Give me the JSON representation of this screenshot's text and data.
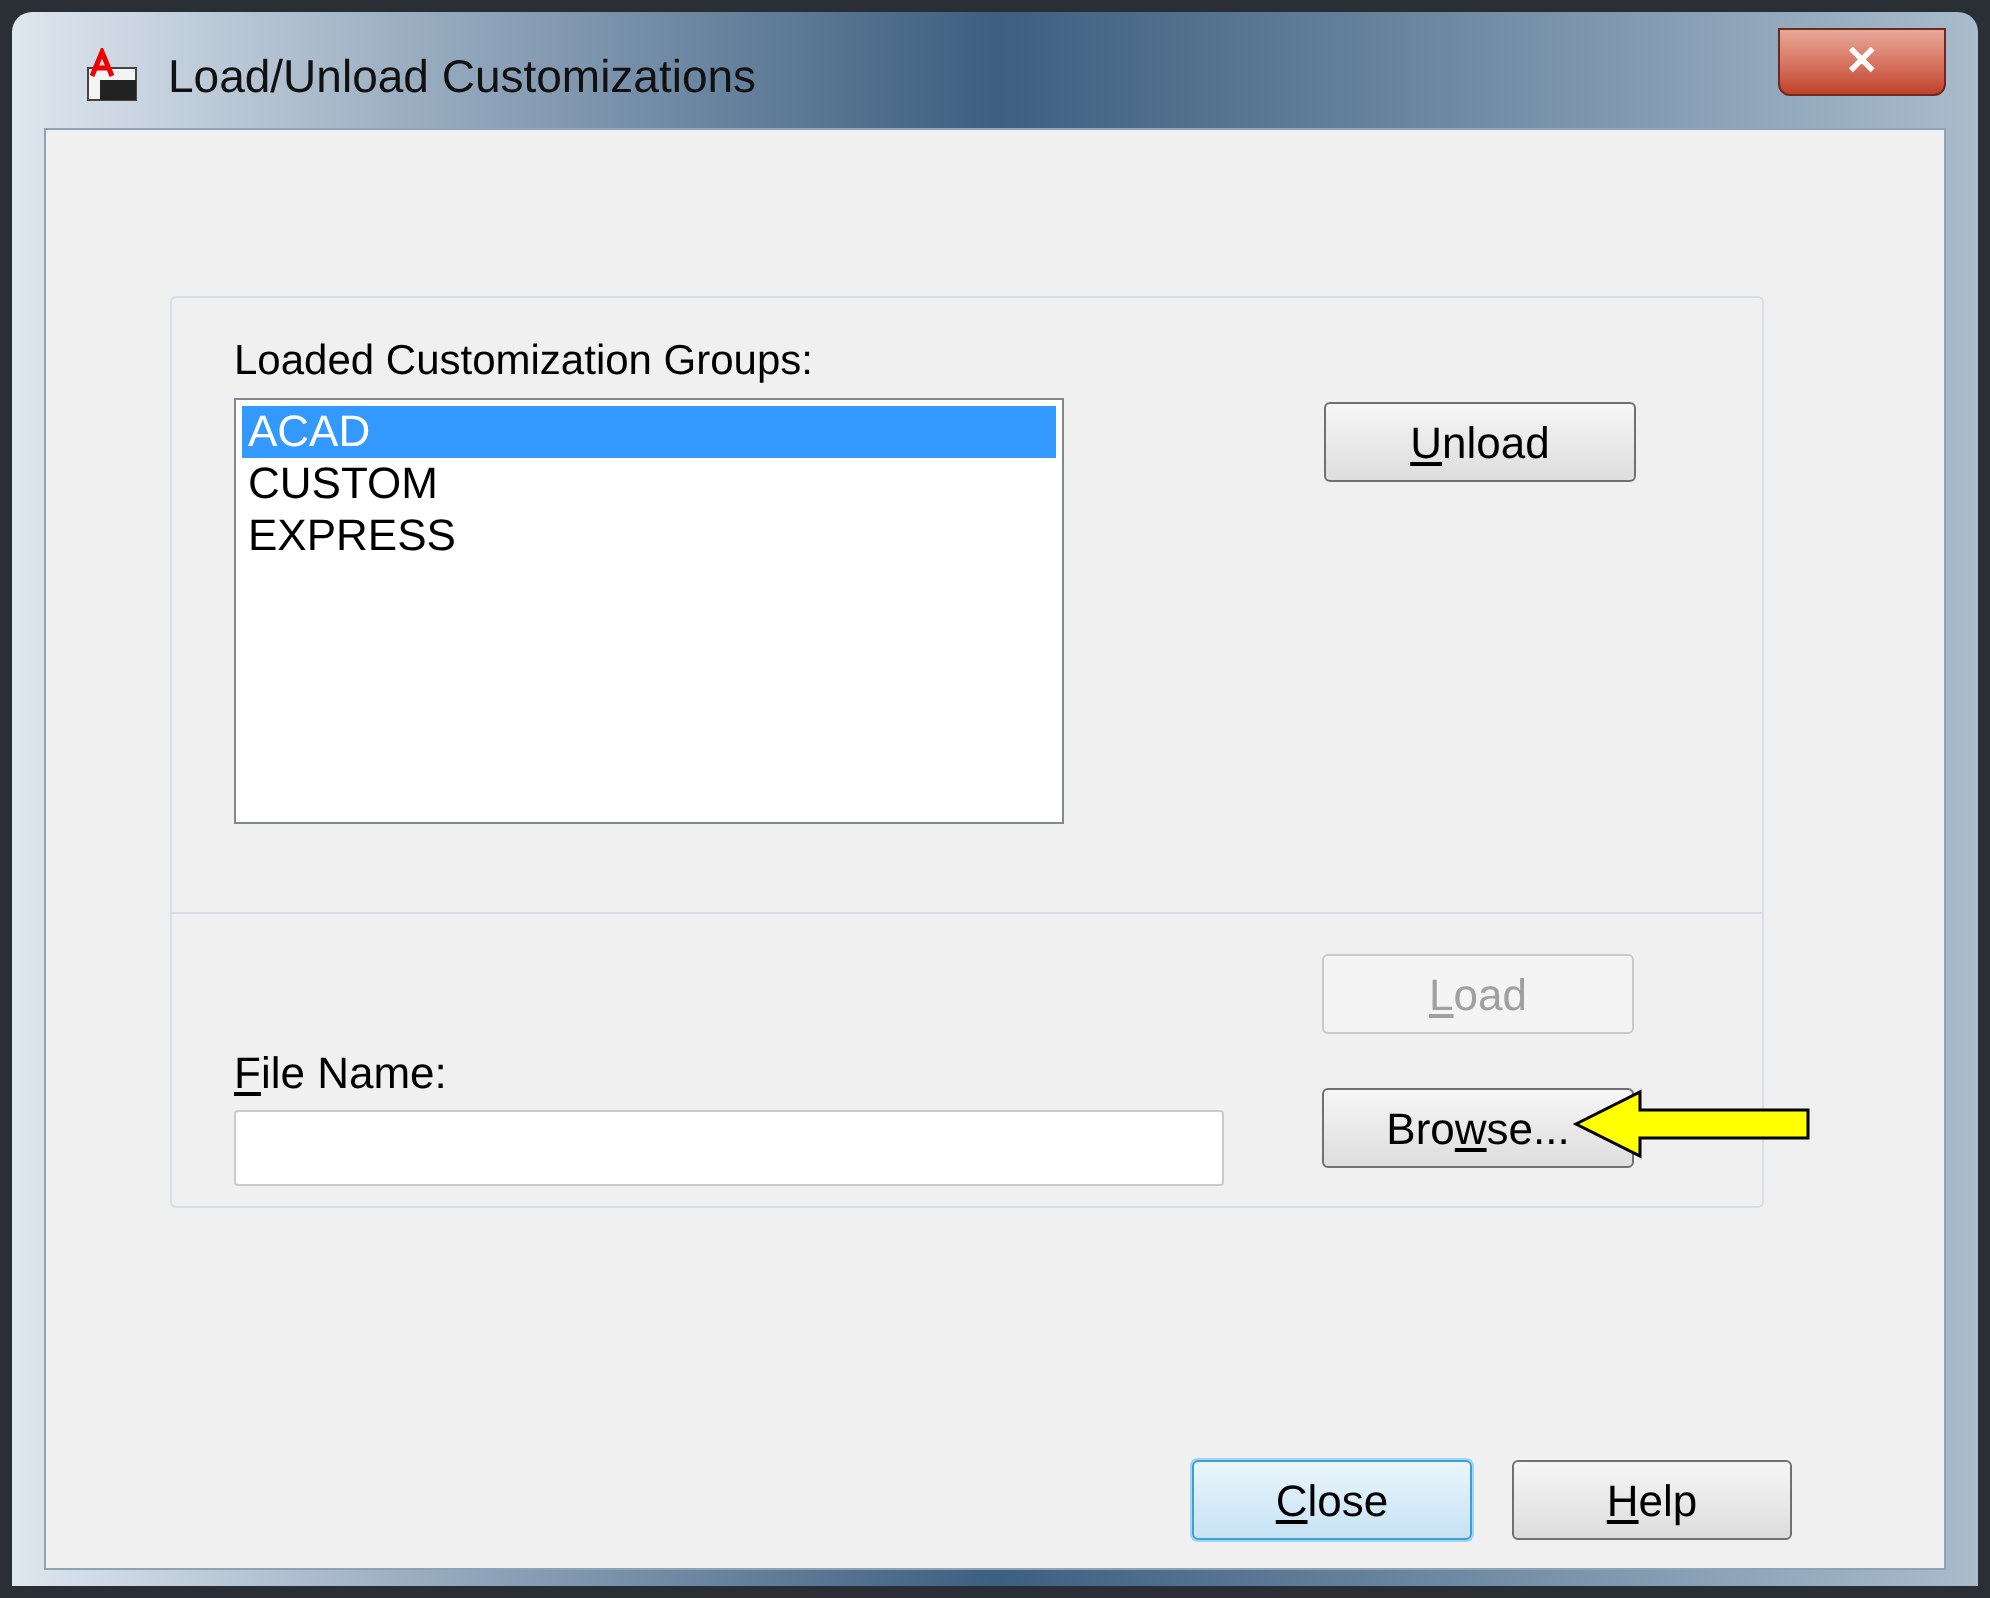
{
  "window": {
    "title": "Load/Unload Customizations",
    "close_glyph": "✕"
  },
  "groups": {
    "label": "Loaded Customization Groups:",
    "items": [
      {
        "label": "ACAD",
        "selected": true
      },
      {
        "label": "CUSTOM",
        "selected": false
      },
      {
        "label": "EXPRESS",
        "selected": false
      }
    ]
  },
  "unload_button": {
    "key": "U",
    "after": "nload",
    "disabled": false
  },
  "file_name": {
    "key": "F",
    "after": "ile Name:"
  },
  "load_button": {
    "key": "L",
    "after": "oad",
    "disabled": true
  },
  "browse_button": {
    "before": "Bro",
    "key": "w",
    "after": "se...",
    "disabled": false
  },
  "footer_buttons": [
    {
      "key": "C",
      "after": "lose",
      "selected": true
    },
    {
      "key": "H",
      "after": "elp",
      "selected": false
    }
  ]
}
